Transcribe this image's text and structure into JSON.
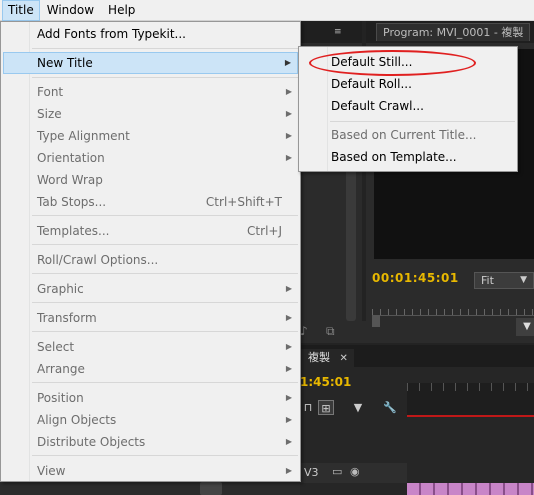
{
  "menubar": {
    "items": [
      "Title",
      "Window",
      "Help"
    ]
  },
  "title_menu": {
    "add_fonts": "Add Fonts from Typekit...",
    "new_title": "New Title",
    "font": "Font",
    "size": "Size",
    "type_alignment": "Type Alignment",
    "orientation": "Orientation",
    "word_wrap": "Word Wrap",
    "tab_stops": "Tab Stops...",
    "tab_stops_shortcut": "Ctrl+Shift+T",
    "templates": "Templates...",
    "templates_shortcut": "Ctrl+J",
    "roll_crawl_options": "Roll/Crawl Options...",
    "graphic": "Graphic",
    "transform": "Transform",
    "select": "Select",
    "arrange": "Arrange",
    "position": "Position",
    "align_objects": "Align Objects",
    "distribute_objects": "Distribute Objects",
    "view": "View"
  },
  "new_title_submenu": {
    "default_still": "Default Still...",
    "default_roll": "Default Roll...",
    "default_crawl": "Default Crawl...",
    "based_on_current": "Based on Current Title...",
    "based_on_template": "Based on Template..."
  },
  "program_monitor": {
    "tab_label": "Program: MVI_0001 - 複製",
    "timecode": "00:01:45:01",
    "zoom": "Fit"
  },
  "timeline": {
    "tab_label": "複製",
    "tab_close": "✕",
    "timecode": "1:45:01",
    "track_label": "V3"
  },
  "colors": {
    "highlight": "#cce4f7",
    "annotation_circle": "#e02020",
    "timecode": "#e8b800"
  },
  "icons": {
    "submenu_arrow": "▶",
    "panel_menu": "≡"
  }
}
